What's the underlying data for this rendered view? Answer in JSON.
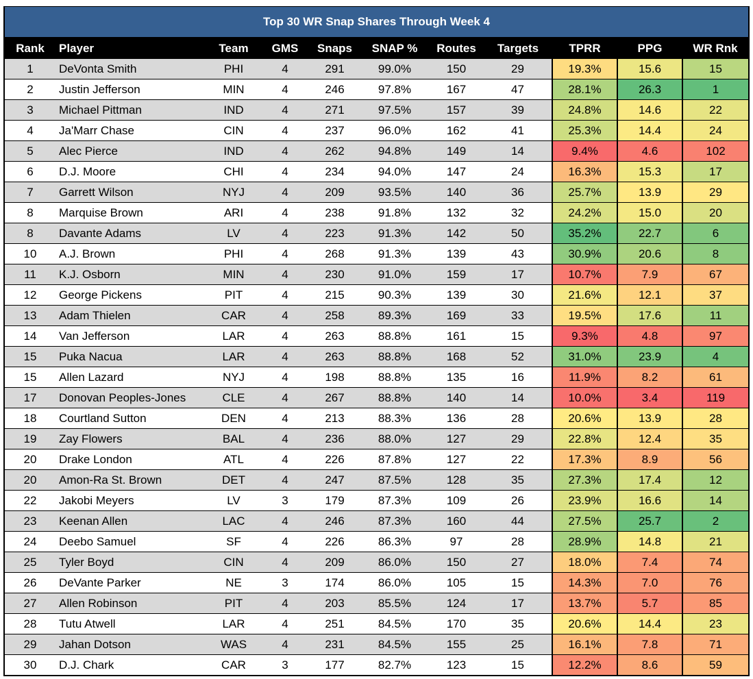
{
  "title": "Top 30 WR Snap Shares Through Week 4",
  "columns": [
    "Rank",
    "Player",
    "Team",
    "GMS",
    "Snaps",
    "SNAP %",
    "Routes",
    "Targets",
    "TPRR",
    "PPG",
    "WR Rnk"
  ],
  "color_scale": {
    "low": "#F8696B",
    "mid": "#FFEB84",
    "high": "#63BE7B"
  },
  "rows": [
    {
      "rank": "1",
      "player": "DeVonta Smith",
      "team": "PHI",
      "gms": "4",
      "snaps": "291",
      "snap_pct": "99.0%",
      "routes": "150",
      "targets": "29",
      "tprr": "19.3%",
      "ppg": "15.6",
      "wr_rnk": "15"
    },
    {
      "rank": "2",
      "player": "Justin Jefferson",
      "team": "MIN",
      "gms": "4",
      "snaps": "246",
      "snap_pct": "97.8%",
      "routes": "167",
      "targets": "47",
      "tprr": "28.1%",
      "ppg": "26.3",
      "wr_rnk": "1"
    },
    {
      "rank": "3",
      "player": "Michael Pittman",
      "team": "IND",
      "gms": "4",
      "snaps": "271",
      "snap_pct": "97.5%",
      "routes": "157",
      "targets": "39",
      "tprr": "24.8%",
      "ppg": "14.6",
      "wr_rnk": "22"
    },
    {
      "rank": "4",
      "player": "Ja'Marr Chase",
      "team": "CIN",
      "gms": "4",
      "snaps": "237",
      "snap_pct": "96.0%",
      "routes": "162",
      "targets": "41",
      "tprr": "25.3%",
      "ppg": "14.4",
      "wr_rnk": "24"
    },
    {
      "rank": "5",
      "player": "Alec Pierce",
      "team": "IND",
      "gms": "4",
      "snaps": "262",
      "snap_pct": "94.8%",
      "routes": "149",
      "targets": "14",
      "tprr": "9.4%",
      "ppg": "4.6",
      "wr_rnk": "102"
    },
    {
      "rank": "6",
      "player": "D.J. Moore",
      "team": "CHI",
      "gms": "4",
      "snaps": "234",
      "snap_pct": "94.0%",
      "routes": "147",
      "targets": "24",
      "tprr": "16.3%",
      "ppg": "15.3",
      "wr_rnk": "17"
    },
    {
      "rank": "7",
      "player": "Garrett Wilson",
      "team": "NYJ",
      "gms": "4",
      "snaps": "209",
      "snap_pct": "93.5%",
      "routes": "140",
      "targets": "36",
      "tprr": "25.7%",
      "ppg": "13.9",
      "wr_rnk": "29"
    },
    {
      "rank": "8",
      "player": "Marquise Brown",
      "team": "ARI",
      "gms": "4",
      "snaps": "238",
      "snap_pct": "91.8%",
      "routes": "132",
      "targets": "32",
      "tprr": "24.2%",
      "ppg": "15.0",
      "wr_rnk": "20"
    },
    {
      "rank": "8",
      "player": "Davante Adams",
      "team": "LV",
      "gms": "4",
      "snaps": "223",
      "snap_pct": "91.3%",
      "routes": "142",
      "targets": "50",
      "tprr": "35.2%",
      "ppg": "22.7",
      "wr_rnk": "6"
    },
    {
      "rank": "10",
      "player": "A.J. Brown",
      "team": "PHI",
      "gms": "4",
      "snaps": "268",
      "snap_pct": "91.3%",
      "routes": "139",
      "targets": "43",
      "tprr": "30.9%",
      "ppg": "20.6",
      "wr_rnk": "8"
    },
    {
      "rank": "11",
      "player": "K.J. Osborn",
      "team": "MIN",
      "gms": "4",
      "snaps": "230",
      "snap_pct": "91.0%",
      "routes": "159",
      "targets": "17",
      "tprr": "10.7%",
      "ppg": "7.9",
      "wr_rnk": "67"
    },
    {
      "rank": "12",
      "player": "George Pickens",
      "team": "PIT",
      "gms": "4",
      "snaps": "215",
      "snap_pct": "90.3%",
      "routes": "139",
      "targets": "30",
      "tprr": "21.6%",
      "ppg": "12.1",
      "wr_rnk": "37"
    },
    {
      "rank": "13",
      "player": "Adam Thielen",
      "team": "CAR",
      "gms": "4",
      "snaps": "258",
      "snap_pct": "89.3%",
      "routes": "169",
      "targets": "33",
      "tprr": "19.5%",
      "ppg": "17.6",
      "wr_rnk": "11"
    },
    {
      "rank": "14",
      "player": "Van Jefferson",
      "team": "LAR",
      "gms": "4",
      "snaps": "263",
      "snap_pct": "88.8%",
      "routes": "161",
      "targets": "15",
      "tprr": "9.3%",
      "ppg": "4.8",
      "wr_rnk": "97"
    },
    {
      "rank": "15",
      "player": "Puka Nacua",
      "team": "LAR",
      "gms": "4",
      "snaps": "263",
      "snap_pct": "88.8%",
      "routes": "168",
      "targets": "52",
      "tprr": "31.0%",
      "ppg": "23.9",
      "wr_rnk": "4"
    },
    {
      "rank": "15",
      "player": "Allen Lazard",
      "team": "NYJ",
      "gms": "4",
      "snaps": "198",
      "snap_pct": "88.8%",
      "routes": "135",
      "targets": "16",
      "tprr": "11.9%",
      "ppg": "8.2",
      "wr_rnk": "61"
    },
    {
      "rank": "17",
      "player": "Donovan Peoples-Jones",
      "team": "CLE",
      "gms": "4",
      "snaps": "267",
      "snap_pct": "88.8%",
      "routes": "140",
      "targets": "14",
      "tprr": "10.0%",
      "ppg": "3.4",
      "wr_rnk": "119"
    },
    {
      "rank": "18",
      "player": "Courtland Sutton",
      "team": "DEN",
      "gms": "4",
      "snaps": "213",
      "snap_pct": "88.3%",
      "routes": "136",
      "targets": "28",
      "tprr": "20.6%",
      "ppg": "13.9",
      "wr_rnk": "28"
    },
    {
      "rank": "19",
      "player": "Zay Flowers",
      "team": "BAL",
      "gms": "4",
      "snaps": "236",
      "snap_pct": "88.0%",
      "routes": "127",
      "targets": "29",
      "tprr": "22.8%",
      "ppg": "12.4",
      "wr_rnk": "35"
    },
    {
      "rank": "20",
      "player": "Drake London",
      "team": "ATL",
      "gms": "4",
      "snaps": "226",
      "snap_pct": "87.8%",
      "routes": "127",
      "targets": "22",
      "tprr": "17.3%",
      "ppg": "8.9",
      "wr_rnk": "56"
    },
    {
      "rank": "20",
      "player": "Amon-Ra St. Brown",
      "team": "DET",
      "gms": "4",
      "snaps": "247",
      "snap_pct": "87.5%",
      "routes": "128",
      "targets": "35",
      "tprr": "27.3%",
      "ppg": "17.4",
      "wr_rnk": "12"
    },
    {
      "rank": "22",
      "player": "Jakobi Meyers",
      "team": "LV",
      "gms": "3",
      "snaps": "179",
      "snap_pct": "87.3%",
      "routes": "109",
      "targets": "26",
      "tprr": "23.9%",
      "ppg": "16.6",
      "wr_rnk": "14"
    },
    {
      "rank": "23",
      "player": "Keenan Allen",
      "team": "LAC",
      "gms": "4",
      "snaps": "246",
      "snap_pct": "87.3%",
      "routes": "160",
      "targets": "44",
      "tprr": "27.5%",
      "ppg": "25.7",
      "wr_rnk": "2"
    },
    {
      "rank": "24",
      "player": "Deebo Samuel",
      "team": "SF",
      "gms": "4",
      "snaps": "226",
      "snap_pct": "86.3%",
      "routes": "97",
      "targets": "28",
      "tprr": "28.9%",
      "ppg": "14.8",
      "wr_rnk": "21"
    },
    {
      "rank": "25",
      "player": "Tyler Boyd",
      "team": "CIN",
      "gms": "4",
      "snaps": "209",
      "snap_pct": "86.0%",
      "routes": "150",
      "targets": "27",
      "tprr": "18.0%",
      "ppg": "7.4",
      "wr_rnk": "74"
    },
    {
      "rank": "26",
      "player": "DeVante Parker",
      "team": "NE",
      "gms": "3",
      "snaps": "174",
      "snap_pct": "86.0%",
      "routes": "105",
      "targets": "15",
      "tprr": "14.3%",
      "ppg": "7.0",
      "wr_rnk": "76"
    },
    {
      "rank": "27",
      "player": "Allen Robinson",
      "team": "PIT",
      "gms": "4",
      "snaps": "203",
      "snap_pct": "85.5%",
      "routes": "124",
      "targets": "17",
      "tprr": "13.7%",
      "ppg": "5.7",
      "wr_rnk": "85"
    },
    {
      "rank": "28",
      "player": "Tutu Atwell",
      "team": "LAR",
      "gms": "4",
      "snaps": "251",
      "snap_pct": "84.5%",
      "routes": "170",
      "targets": "35",
      "tprr": "20.6%",
      "ppg": "14.4",
      "wr_rnk": "23"
    },
    {
      "rank": "29",
      "player": "Jahan Dotson",
      "team": "WAS",
      "gms": "4",
      "snaps": "231",
      "snap_pct": "84.5%",
      "routes": "155",
      "targets": "25",
      "tprr": "16.1%",
      "ppg": "7.8",
      "wr_rnk": "71"
    },
    {
      "rank": "30",
      "player": "D.J. Chark",
      "team": "CAR",
      "gms": "3",
      "snaps": "177",
      "snap_pct": "82.7%",
      "routes": "123",
      "targets": "15",
      "tprr": "12.2%",
      "ppg": "8.6",
      "wr_rnk": "59"
    }
  ]
}
